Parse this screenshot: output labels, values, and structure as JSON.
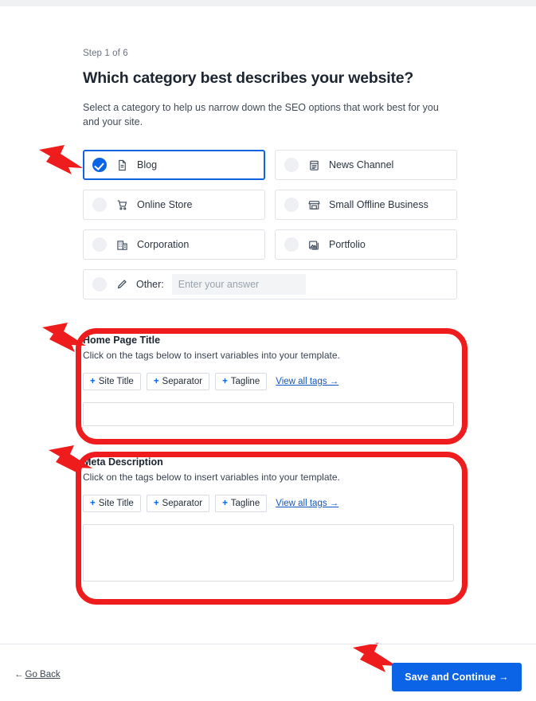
{
  "step": {
    "label": "Step 1 of 6"
  },
  "heading": {
    "title": "Which category best describes your website?",
    "subtitle": "Select a category to help us narrow down the SEO options that work best for you and your site."
  },
  "categories": [
    {
      "label": "Blog",
      "icon": "document-icon",
      "selected": true
    },
    {
      "label": "News Channel",
      "icon": "newspaper-icon",
      "selected": false
    },
    {
      "label": "Online Store",
      "icon": "shopping-cart-icon",
      "selected": false
    },
    {
      "label": "Small Offline Business",
      "icon": "storefront-icon",
      "selected": false
    },
    {
      "label": "Corporation",
      "icon": "building-icon",
      "selected": false
    },
    {
      "label": "Portfolio",
      "icon": "images-icon",
      "selected": false
    }
  ],
  "other": {
    "label": "Other:",
    "icon": "pencil-icon",
    "placeholder": "Enter your answer",
    "value": "",
    "selected": false
  },
  "home_page_title": {
    "heading": "Home Page Title",
    "hint": "Click on the tags below to insert variables into your template.",
    "tags": [
      {
        "plus": "+",
        "label": "Site Title"
      },
      {
        "plus": "+",
        "label": "Separator"
      },
      {
        "plus": "+",
        "label": "Tagline"
      }
    ],
    "view_all": "View all tags →",
    "value": "",
    "placeholder": ""
  },
  "meta_description": {
    "heading": "Meta Description",
    "hint": "Click on the tags below to insert variables into your template.",
    "tags": [
      {
        "plus": "+",
        "label": "Site Title"
      },
      {
        "plus": "+",
        "label": "Separator"
      },
      {
        "plus": "+",
        "label": "Tagline"
      }
    ],
    "view_all": "View all tags →",
    "value": "",
    "placeholder": ""
  },
  "footer": {
    "go_back_arrow": "←",
    "go_back_label": "Go Back",
    "save_label": "Save and Continue →"
  },
  "colors": {
    "accent_blue": "#0b63e5",
    "annotation_red": "#ee1c1c",
    "border_grey": "#dfe3e8",
    "text_dark": "#1c2530"
  },
  "annotations": {
    "arrows": [
      {
        "name": "arrow-to-blog-option",
        "target": "Blog category option"
      },
      {
        "name": "arrow-to-home-page-title",
        "target": "Home Page Title section"
      },
      {
        "name": "arrow-to-meta-description",
        "target": "Meta Description section"
      },
      {
        "name": "arrow-to-save-continue",
        "target": "Save and Continue button"
      }
    ],
    "boxes": [
      {
        "name": "highlight-box-home-page-title"
      },
      {
        "name": "highlight-box-meta-description"
      }
    ]
  }
}
